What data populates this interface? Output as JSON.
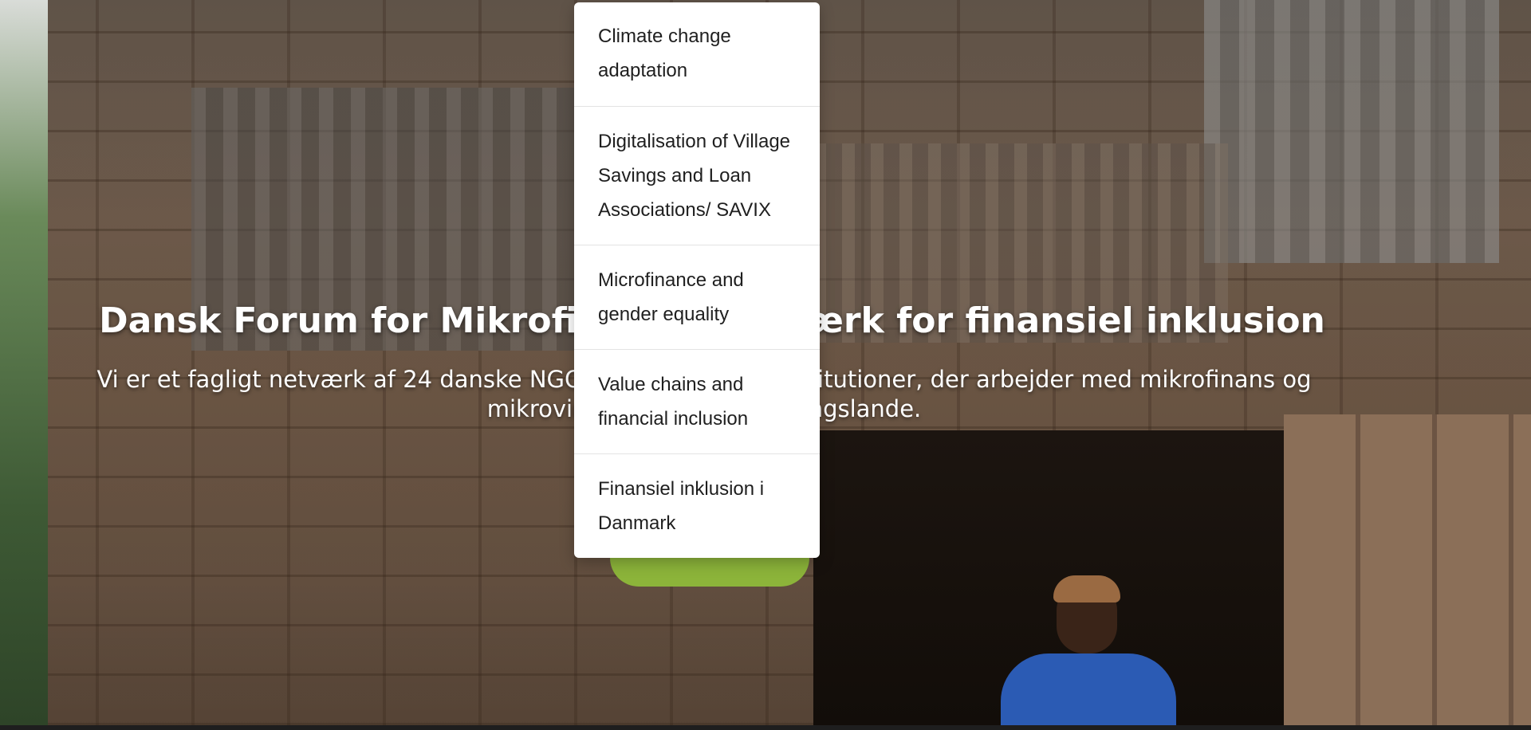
{
  "hero": {
    "title": "Dansk Forum for Mikrofinans – Netværk for finansiel inklusion",
    "subtitle": "Vi er et fagligt netværk af 24 danske NGOer og finansielle institutioner, der arbejder med mikrofinans og mikrovirksomheder i udviklingslande."
  },
  "dropdown": {
    "items": [
      {
        "label": "Climate change adaptation"
      },
      {
        "label": "Digitalisation of Village Savings and Loan Associations/ SAVIX"
      },
      {
        "label": "Microfinance and gender equality"
      },
      {
        "label": "Value chains and financial inclusion"
      },
      {
        "label": "Finansiel inklusion i Danmark"
      }
    ]
  },
  "colors": {
    "accent": "#8cb43a",
    "text_light": "#ffffff",
    "menu_text": "#1f1f1f"
  }
}
